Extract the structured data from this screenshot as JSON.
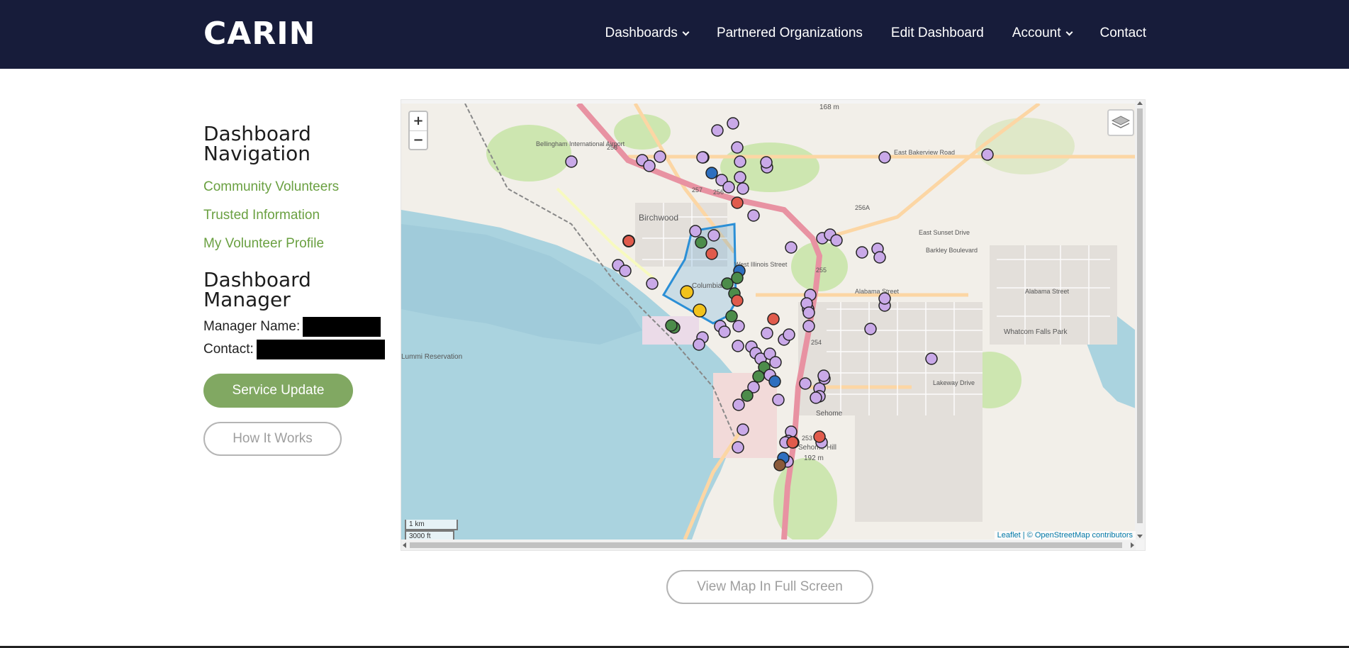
{
  "header": {
    "brand": "CARIN",
    "nav": [
      {
        "label": "Dashboards",
        "dropdown": true
      },
      {
        "label": "Partnered Organizations",
        "dropdown": false
      },
      {
        "label": "Edit Dashboard",
        "dropdown": false
      },
      {
        "label": "Account",
        "dropdown": true
      },
      {
        "label": "Contact",
        "dropdown": false
      }
    ]
  },
  "sidebar": {
    "nav_heading": "Dashboard Navigation",
    "links": [
      "Community Volunteers",
      "Trusted Information",
      "My Volunteer Profile"
    ],
    "manager_heading": "Dashboard Manager",
    "manager_name_label": "Manager Name:",
    "contact_label": "Contact:",
    "service_update_label": "Service Update",
    "how_it_works_label": "How It Works"
  },
  "map": {
    "zoom_in": "+",
    "zoom_out": "−",
    "scale_km": "1 km",
    "scale_ft": "3000 ft",
    "attribution": "Leaflet | © OpenStreetMap contributors",
    "labels": {
      "birchwood": "Birchwood",
      "columbia": "Columbia",
      "sehome": "Sehome",
      "sehome_hill": "Sehome Hill",
      "sehome_hill_elev": "192 m",
      "whatcom_falls": "Whatcom Falls Park",
      "airport": "Bellingham International Airport",
      "lummi": "Lummi Reservation",
      "east_bakerview": "East Bakerview Road",
      "barkley": "Barkley Boulevard",
      "alabama_w": "Alabama Street",
      "alabama_e": "Alabama Street",
      "lakeway": "Lakeway Drive",
      "east_sunset": "East Sunset Drive",
      "west_street": "West Illinois Street",
      "elev_top": "168 m",
      "exit_258": "258",
      "exit_257": "257",
      "exit_256": "256",
      "exit_256a": "256A",
      "exit_255": "255",
      "exit_254": "254",
      "exit_253": "253"
    },
    "colors": {
      "water": "#aad3df",
      "land": "#f2efe9",
      "park": "#c8e6a8",
      "highway": "#e892a2",
      "primary": "#fcd6a4",
      "marker_purple": "#c9a9e8",
      "marker_green": "#4c8c4a",
      "marker_red": "#e05b4c",
      "marker_blue": "#2e6fbf",
      "marker_yellow": "#f2c21c",
      "polygon": "#2b8fd6"
    }
  },
  "fullscreen_label": "View Map In Full Screen"
}
